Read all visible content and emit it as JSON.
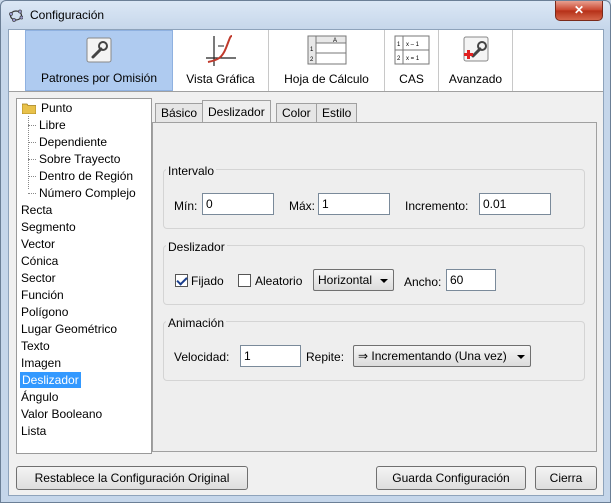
{
  "window": {
    "title": "Configuración",
    "close_glyph": "✕"
  },
  "toolbar": {
    "items": [
      {
        "label": "Patrones por Omisión",
        "icon": "wrench-icon"
      },
      {
        "label": "Vista Gráfica",
        "icon": "graph-icon"
      },
      {
        "label": "Hoja de Cálculo",
        "icon": "spreadsheet-icon"
      },
      {
        "label": "CAS",
        "icon": "cas-icon"
      },
      {
        "label": "Avanzado",
        "icon": "advanced-wrench-icon"
      }
    ],
    "spreadsheet_icon_text": {
      "col": "A",
      "r1": "1",
      "r2": "2"
    },
    "cas_icon_text": {
      "r1n": "1",
      "r1t": "x – 1",
      "r2n": "2",
      "r2t": "x = 1"
    }
  },
  "tree": {
    "root": "Punto",
    "children": [
      "Libre",
      "Dependiente",
      "Sobre Trayecto",
      "Dentro de Región",
      "Número Complejo"
    ],
    "items": [
      "Recta",
      "Segmento",
      "Vector",
      "Cónica",
      "Sector",
      "Función",
      "Polígono",
      "Lugar Geométrico",
      "Texto",
      "Imagen",
      "Deslizador",
      "Ángulo",
      "Valor Booleano",
      "Lista"
    ],
    "selected": "Deslizador"
  },
  "tabs": [
    "Básico",
    "Deslizador",
    "Color",
    "Estilo"
  ],
  "active_tab": "Deslizador",
  "intervalo": {
    "title": "Intervalo",
    "min_label": "Mín:",
    "min_value": "0",
    "max_label": "Máx:",
    "max_value": "1",
    "inc_label": "Incremento:",
    "inc_value": "0.01"
  },
  "deslizador": {
    "title": "Deslizador",
    "fijado_label": "Fijado",
    "fijado_checked": true,
    "aleatorio_label": "Aleatorio",
    "aleatorio_checked": false,
    "orientation": "Horizontal",
    "ancho_label": "Ancho:",
    "ancho_value": "60"
  },
  "animacion": {
    "title": "Animación",
    "velocidad_label": "Velocidad:",
    "velocidad_value": "1",
    "repite_label": "Repite:",
    "repite_value": "⇒ Incrementando (Una vez)"
  },
  "buttons": {
    "reset": "Restablece la Configuración Original",
    "save": "Guarda Configuración",
    "close": "Cierra"
  }
}
